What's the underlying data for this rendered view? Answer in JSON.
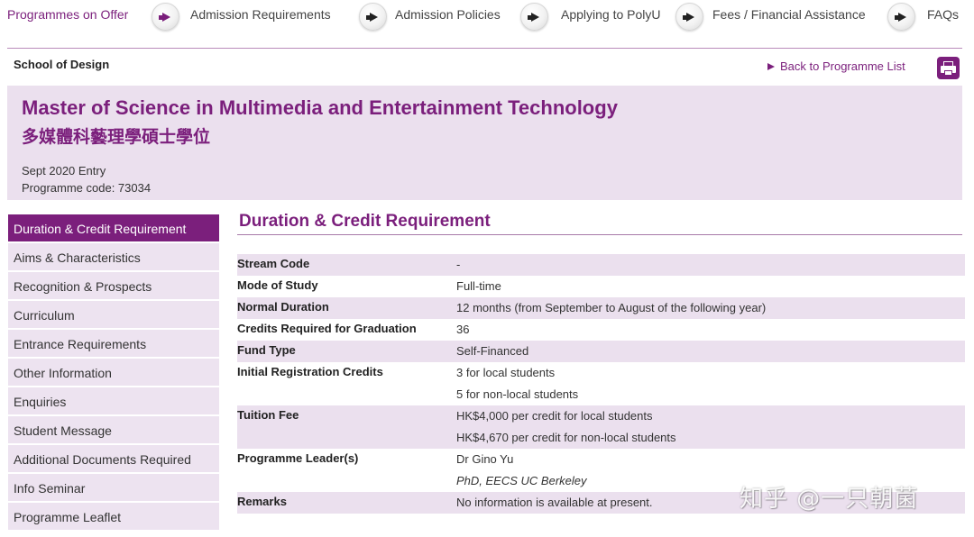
{
  "topnav": {
    "items": [
      {
        "label": "Programmes on Offer",
        "active": true
      },
      {
        "label": "Admission Requirements"
      },
      {
        "label": "Admission Policies"
      },
      {
        "label": "Applying to PolyU"
      },
      {
        "label": "Fees / Financial Assistance"
      },
      {
        "label": "FAQs"
      }
    ]
  },
  "school": {
    "name": "School of Design",
    "back_link": "Back to Programme List",
    "print_icon": "printer-icon"
  },
  "programme": {
    "title_en": "Master of Science in Multimedia and Entertainment Technology",
    "title_zh": "多媒體科藝理學碩士學位",
    "entry": "Sept 2020 Entry",
    "code": "Programme code: 73034"
  },
  "sidebar": {
    "items": [
      {
        "label": "Duration & Credit Requirement",
        "active": true
      },
      {
        "label": "Aims & Characteristics"
      },
      {
        "label": "Recognition & Prospects"
      },
      {
        "label": "Curriculum"
      },
      {
        "label": "Entrance Requirements"
      },
      {
        "label": "Other Information"
      },
      {
        "label": "Enquiries"
      },
      {
        "label": "Student Message"
      },
      {
        "label": "Additional Documents Required"
      },
      {
        "label": "Info Seminar"
      },
      {
        "label": "Programme Leaflet"
      }
    ]
  },
  "content": {
    "title": "Duration & Credit Requirement",
    "rows": [
      {
        "label": "Stream Code",
        "values": [
          "-"
        ]
      },
      {
        "label": "Mode of Study",
        "values": [
          "Full-time"
        ]
      },
      {
        "label": "Normal Duration",
        "values": [
          "12 months (from September to August of the following year)"
        ]
      },
      {
        "label": "Credits Required for Graduation",
        "values": [
          "36"
        ]
      },
      {
        "label": "Fund Type",
        "values": [
          "Self-Financed"
        ]
      },
      {
        "label": "Initial Registration Credits",
        "values": [
          "3 for local students",
          "5 for non-local students"
        ]
      },
      {
        "label": "Tuition Fee",
        "values": [
          "HK$4,000 per credit for local students",
          "HK$4,670 per credit for non-local students"
        ]
      },
      {
        "label": "Programme Leader(s)",
        "values": [
          "Dr Gino Yu",
          "PhD, EECS UC Berkeley"
        ]
      },
      {
        "label": "Remarks",
        "values": [
          "No information is available at present."
        ]
      }
    ]
  },
  "watermark": {
    "text": "知乎 @一只朝菌"
  },
  "colors": {
    "brand_purple": "#7b1f7c",
    "light_purple": "#ebe0ee"
  }
}
